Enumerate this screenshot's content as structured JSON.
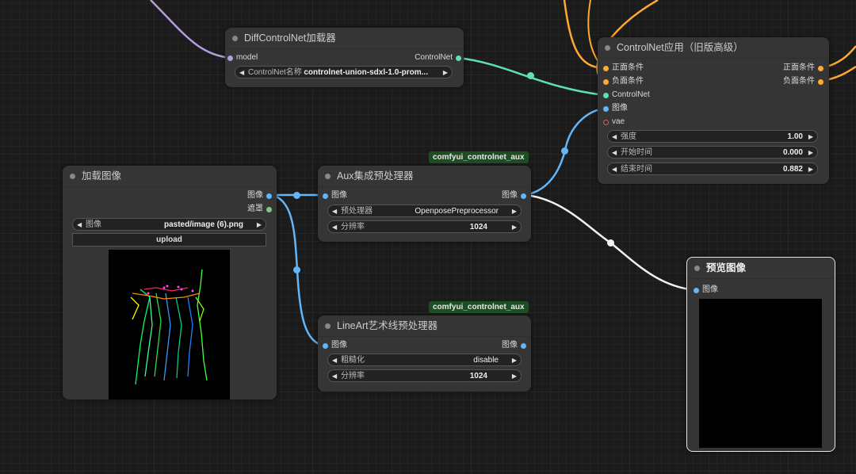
{
  "colors": {
    "model": "#b39ddb",
    "controlnet": "#5fe0b0",
    "image": "#64b5f6",
    "mask": "#81c784",
    "conditioning": "#ffa931",
    "vae": "#ff6e6e",
    "node_bg": "#353535",
    "canvas": "#1b1b1b"
  },
  "diffcontrol": {
    "title": "DiffControlNet加载器",
    "in_model": "model",
    "out_controlnet": "ControlNet",
    "name_label": "ControlNet名称",
    "name_value": "controlnet-union-sdxl-1.0-prom..."
  },
  "apply": {
    "title": "ControlNet应用（旧版高级）",
    "in_pos": "正面条件",
    "in_neg": "负面条件",
    "in_cn": "ControlNet",
    "in_image": "图像",
    "in_vae": "vae",
    "out_pos": "正面条件",
    "out_neg": "负面条件",
    "strength_label": "强度",
    "strength_value": "1.00",
    "start_label": "开始时间",
    "start_value": "0.000",
    "end_label": "结束时间",
    "end_value": "0.882"
  },
  "load": {
    "title": "加载图像",
    "out_image": "图像",
    "out_mask": "遮罩",
    "image_label": "图像",
    "image_value": "pasted/image (6).png",
    "upload_label": "upload"
  },
  "aux": {
    "badge": "comfyui_controlnet_aux",
    "title": "Aux集成预处理器",
    "in_image": "图像",
    "out_image": "图像",
    "pre_label": "预处理器",
    "pre_value": "OpenposePreprocessor",
    "res_label": "分辨率",
    "res_value": "1024"
  },
  "lineart": {
    "badge": "comfyui_controlnet_aux",
    "title": "LineArt艺术线预处理器",
    "in_image": "图像",
    "out_image": "图像",
    "coarse_label": "粗糙化",
    "coarse_value": "disable",
    "res_label": "分辨率",
    "res_value": "1024"
  },
  "preview": {
    "title": "预览图像",
    "in_image": "图像"
  }
}
